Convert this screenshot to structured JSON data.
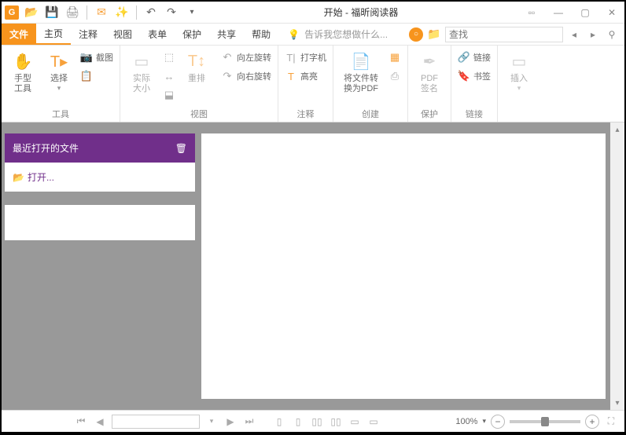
{
  "title": "开始 - 福昕阅读器",
  "qat": {
    "open_color": "#f7a13b",
    "save_color": "#8aa5c7"
  },
  "tabs": {
    "file": "文件",
    "home": "主页",
    "comment": "注释",
    "view": "视图",
    "form": "表单",
    "protect": "保护",
    "share": "共享",
    "help": "帮助"
  },
  "tellme": "告诉我您想做什么...",
  "search": {
    "placeholder": "查找"
  },
  "ribbon": {
    "tools": {
      "label": "工具",
      "hand": "手型\n工具",
      "select": "选择",
      "snapshot": "截图"
    },
    "view": {
      "label": "视图",
      "actual": "实际\n大小",
      "reflow": "重排",
      "rotate_left": "向左旋转",
      "rotate_right": "向右旋转"
    },
    "comment": {
      "label": "注释",
      "typewriter": "打字机",
      "highlight": "高亮"
    },
    "create": {
      "label": "创建",
      "convert": "将文件转\n换为PDF"
    },
    "protect": {
      "label": "保护",
      "sign": "PDF\n签名"
    },
    "links": {
      "label": "链接",
      "link": "链接",
      "bookmark": "书签"
    },
    "insert": "插入"
  },
  "sidebar": {
    "header": "最近打开的文件",
    "open": "打开..."
  },
  "status": {
    "zoom": "100%"
  }
}
